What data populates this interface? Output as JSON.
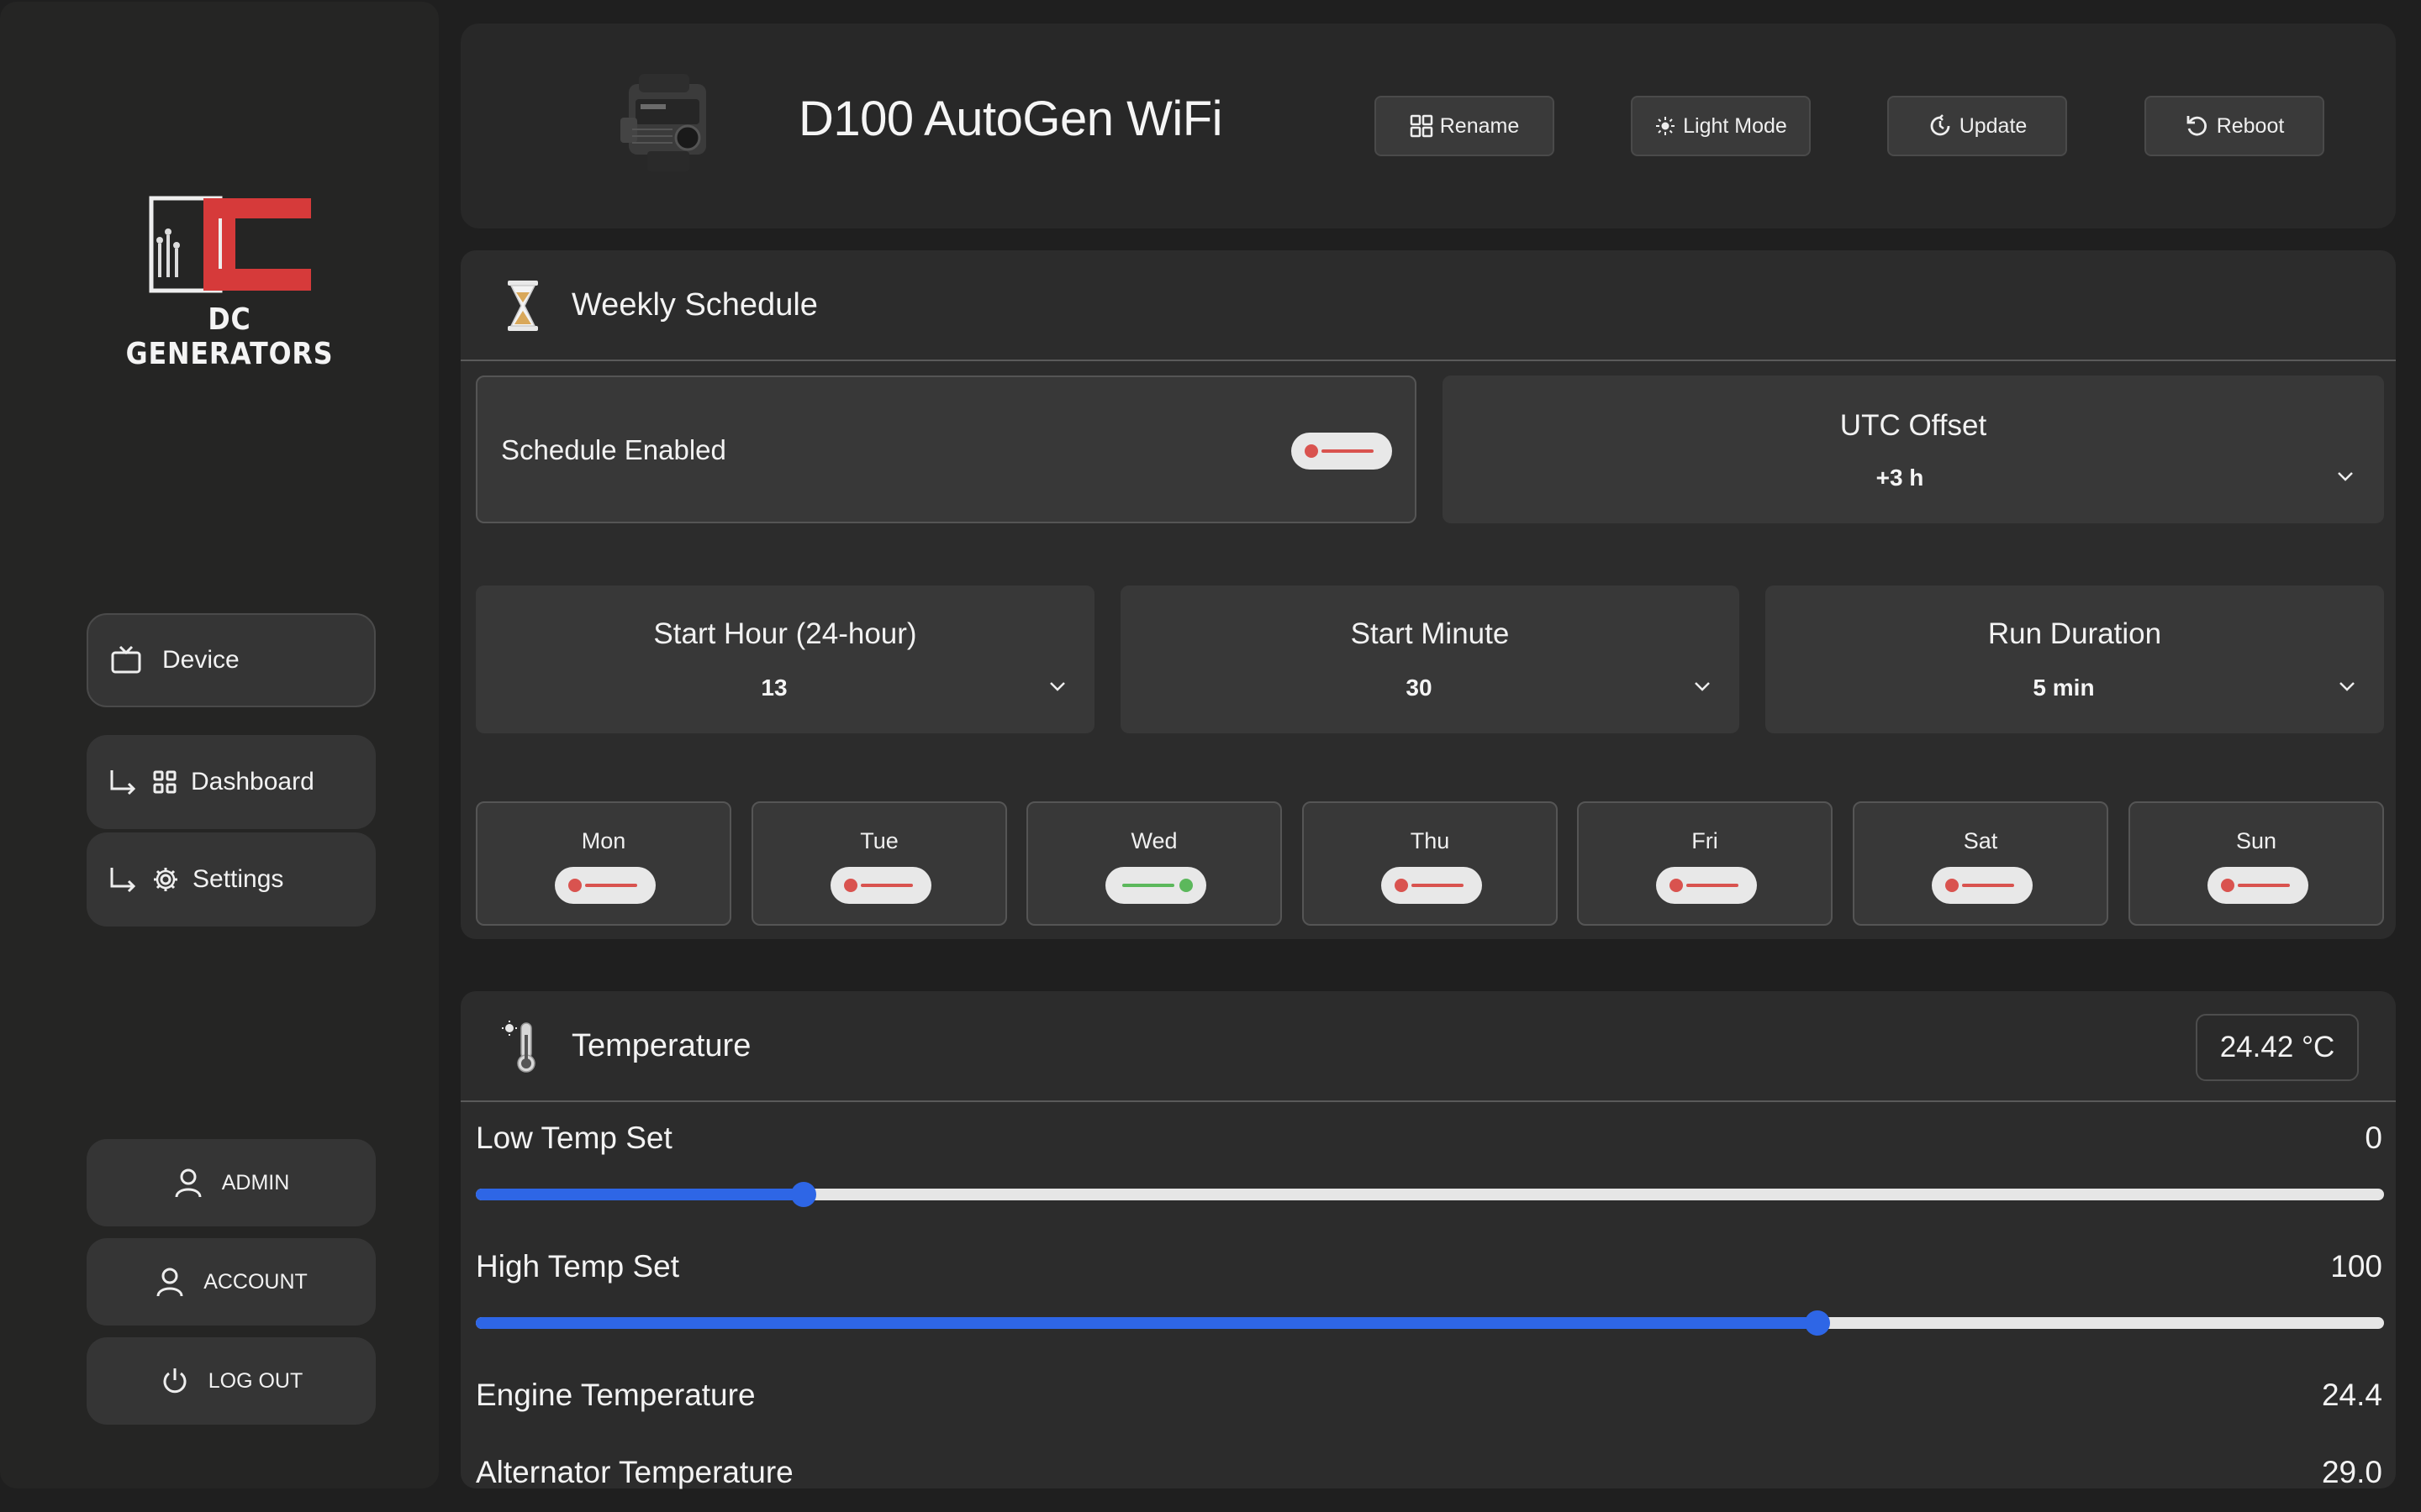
{
  "brand": {
    "name": "DC GENERATORS"
  },
  "sidebar": {
    "nav": [
      {
        "label": "Device"
      },
      {
        "label": "Dashboard"
      },
      {
        "label": "Settings"
      }
    ],
    "account": [
      {
        "label": "ADMIN"
      },
      {
        "label": "ACCOUNT"
      },
      {
        "label": "LOG OUT"
      }
    ]
  },
  "header": {
    "title": "D100 AutoGen WiFi",
    "buttons": [
      {
        "label": "Rename",
        "icon": "grid-icon"
      },
      {
        "label": "Light Mode",
        "icon": "sun-icon"
      },
      {
        "label": "Update",
        "icon": "refresh-icon"
      },
      {
        "label": "Reboot",
        "icon": "rotate-ccw-icon"
      }
    ]
  },
  "schedule": {
    "title": "Weekly Schedule",
    "enabled_label": "Schedule Enabled",
    "enabled": false,
    "utc": {
      "label": "UTC Offset",
      "value": "+3 h"
    },
    "start_hour": {
      "label": "Start Hour (24-hour)",
      "value": "13"
    },
    "start_minute": {
      "label": "Start Minute",
      "value": "30"
    },
    "run_duration": {
      "label": "Run Duration",
      "value": "5 min"
    },
    "days": [
      {
        "label": "Mon",
        "on": false
      },
      {
        "label": "Tue",
        "on": false
      },
      {
        "label": "Wed",
        "on": true
      },
      {
        "label": "Thu",
        "on": false
      },
      {
        "label": "Fri",
        "on": false
      },
      {
        "label": "Sat",
        "on": false
      },
      {
        "label": "Sun",
        "on": false
      }
    ]
  },
  "temperature": {
    "title": "Temperature",
    "current": "24.42 °C",
    "low": {
      "label": "Low Temp Set",
      "value": "0",
      "fraction": 0.172
    },
    "high": {
      "label": "High Temp Set",
      "value": "100",
      "fraction": 0.703
    },
    "engine": {
      "label": "Engine Temperature",
      "value": "24.4"
    },
    "alternator": {
      "label": "Alternator Temperature",
      "value": "29.0"
    }
  },
  "colors": {
    "accent": "#2e66e6",
    "toggle_off": "#d9534f",
    "toggle_on": "#5cb85c",
    "logo_red": "#d63a3a"
  }
}
